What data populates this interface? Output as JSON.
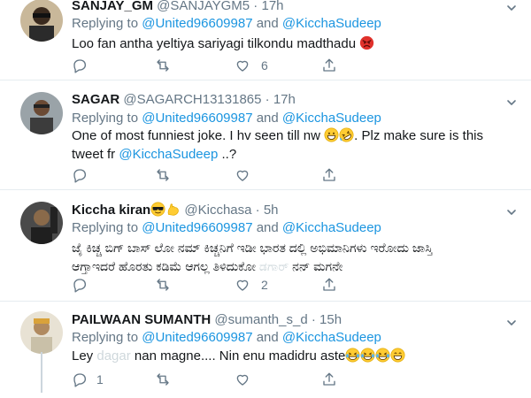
{
  "colors": {
    "link": "#1b95e0",
    "muted": "#657786",
    "text": "#14171a",
    "divider": "#e6ecf0"
  },
  "tweets": [
    {
      "name": "SANJAY_GM",
      "handle": "@SANJAYGM5",
      "dot": " · ",
      "time": "17h",
      "reply_prefix": "Replying to ",
      "mention1": "@United96609987",
      "and": " and ",
      "mention2": "@KicchaSudeep",
      "text": "Loo fan antha yeltiya sariyagi tilkondu madthadu",
      "emoji": [
        "angry-face"
      ],
      "reply_count": "",
      "retweet_count": "",
      "like_count": "6"
    },
    {
      "name": "SAGAR",
      "handle": "@SAGARCH13131865",
      "dot": " · ",
      "time": "17h",
      "reply_prefix": "Replying to ",
      "mention1": "@United96609987",
      "and": " and ",
      "mention2": "@KicchaSudeep",
      "text1": "One of most funniest joke. I hv seen till nw ",
      "text2": ". Plz make sure is this",
      "text3": "tweet fr ",
      "text3_mention": "@KicchaSudeep",
      "text3_end": " ..?",
      "emoji": [
        "grinning-face",
        "rolling-laughing-face"
      ],
      "reply_count": "",
      "retweet_count": "",
      "like_count": ""
    },
    {
      "name": "Kiccha kiran",
      "handle": "@Kicchasa",
      "dot": " · ",
      "time": "5h",
      "reply_prefix": "Replying to ",
      "mention1": "@United96609987",
      "and": " and ",
      "mention2": "@KicchaSudeep",
      "line1": "ಜೈ ಕಿಚ್ಚ ಬಿಗ್ ಬಾಸ್ ಲೋ ನಮ್ ಕಿಚ್ಚನಿಗೆ ಇಡೀ ಭಾರತ ದಲ್ಲಿ ಅಭಿಮಾನಿಗಳು ಇರೋದು ಜಾಸ್ತಿ",
      "line2_a": "ಆಗ್ತಾಇದರೆ ಹೊರತು ಕಡಿಮೆ ಆಗಲ್ಲ ತಿಳಿದುಕೋ ",
      "line2_faded": "ಡಗಾರ್",
      "line2_b": " ನನ್ ಮಗನೇ",
      "emoji": [
        "sunglasses-face",
        "flexed-biceps"
      ],
      "reply_count": "",
      "retweet_count": "",
      "like_count": "2"
    },
    {
      "name": "PAILWAAN SUMANTH",
      "handle": "@sumanth_s_d",
      "dot": " · ",
      "time": "15h",
      "reply_prefix": "Replying to ",
      "mention1": "@United96609987",
      "and": " and ",
      "mention2": "@KicchaSudeep",
      "text_a": "Ley ",
      "text_faded": "dagar",
      "text_b": " nan magne.... Nin enu madidru aste",
      "emoji": [
        "tears-of-joy",
        "tears-of-joy",
        "tears-of-joy",
        "grinning-face"
      ],
      "reply_count": "1",
      "retweet_count": "",
      "like_count": ""
    }
  ],
  "icons": [
    "reply-icon",
    "retweet-icon",
    "like-icon",
    "share-icon",
    "caret-down-icon"
  ]
}
